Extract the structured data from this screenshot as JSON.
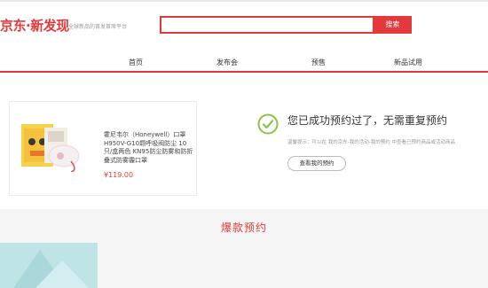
{
  "header": {
    "logo_text": "京东·新发现",
    "slogan": "全球新品的首发首席平台",
    "search": {
      "value": "",
      "placeholder": ""
    },
    "search_button": "搜索"
  },
  "nav": {
    "items": [
      {
        "label": "首页"
      },
      {
        "label": "发布会"
      },
      {
        "label": "预售"
      },
      {
        "label": "新品试用"
      }
    ]
  },
  "product": {
    "name": "霍尼韦尔（Honeywell）口罩 H950V-G10颗呼吸阀防尘 10只/盒两色 KN95防尘防雾和防折叠式防雾霾口罩",
    "price": "¥119.00"
  },
  "result": {
    "title": "您已成功预约过了，无需重复预约",
    "note": "温馨提示：可以在 我的京东-我的活动-我的预约 中查看已预约商品或活动商品",
    "view_button": "查看我的预约"
  },
  "section": {
    "title": "爆款预约"
  },
  "colors": {
    "accent": "#e4393c",
    "success": "#8bc34a",
    "banner": "#bfe4e6"
  }
}
